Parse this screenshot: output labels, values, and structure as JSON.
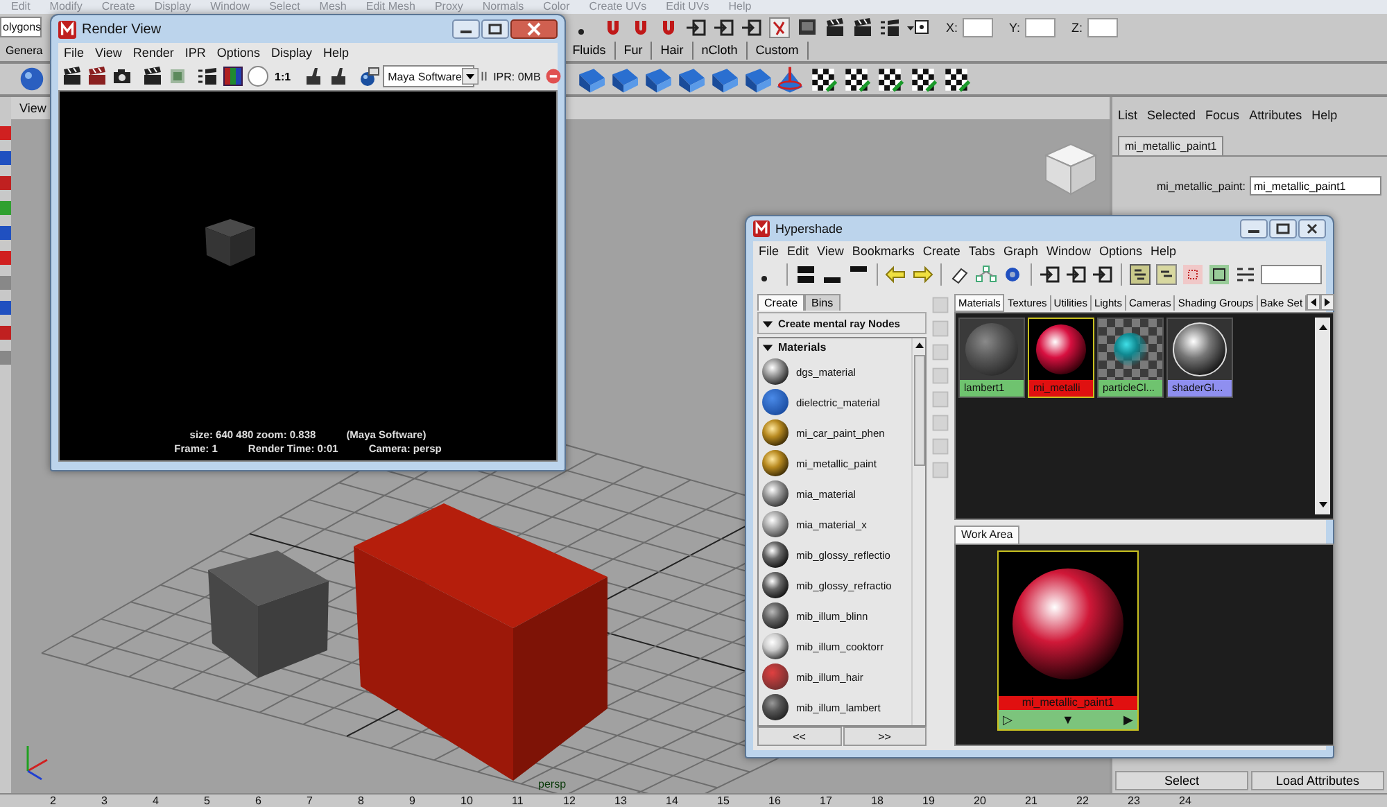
{
  "app": {
    "menu_bar": [
      "Edit",
      "Modify",
      "Create",
      "Display",
      "Window",
      "Select",
      "Mesh",
      "Edit Mesh",
      "Proxy",
      "Normals",
      "Color",
      "Create UVs",
      "Edit UVs",
      "Help"
    ],
    "menu_set": "olygons",
    "coordinate_fields": [
      {
        "label": "X:"
      },
      {
        "label": "Y:"
      },
      {
        "label": "Z:"
      }
    ],
    "shelf_tabs": [
      {
        "label": "Genera"
      },
      {
        "label": "Fluids"
      },
      {
        "label": "Fur"
      },
      {
        "label": "Hair"
      },
      {
        "label": "nCloth"
      },
      {
        "label": "Custom"
      }
    ]
  },
  "viewport": {
    "panel_menu": "View",
    "camera": "persp"
  },
  "attribute_editor": {
    "menu": [
      "List",
      "Selected",
      "Focus",
      "Attributes",
      "Help"
    ],
    "tabs": [
      {
        "label": "mi_metallic_paint1",
        "selected": true
      }
    ],
    "field": {
      "label": "mi_metallic_paint:",
      "value": "mi_metallic_paint1"
    },
    "buttons": [
      "Select",
      "Load Attributes"
    ]
  },
  "timeline": {
    "frames": [
      "2",
      "3",
      "4",
      "5",
      "6",
      "7",
      "8",
      "9",
      "10",
      "11",
      "12",
      "13",
      "14",
      "15",
      "16",
      "17",
      "18",
      "19",
      "20",
      "21",
      "22",
      "23",
      "24"
    ]
  },
  "render_view": {
    "title": "Render View",
    "menu": [
      "File",
      "View",
      "Render",
      "IPR",
      "Options",
      "Display",
      "Help"
    ],
    "zoom_button": "1:1",
    "renderer": "Maya Software",
    "ipr_memory": "IPR: 0MB",
    "info_lines": [
      [
        "size:  640  480 zoom: 0.838",
        "(Maya Software)"
      ],
      [
        "Frame: 1",
        "Render Time: 0:01",
        "Camera: persp"
      ]
    ]
  },
  "hypershade": {
    "title": "Hypershade",
    "menu": [
      "File",
      "Edit",
      "View",
      "Bookmarks",
      "Create",
      "Tabs",
      "Graph",
      "Window",
      "Options",
      "Help"
    ],
    "left_tabs": [
      {
        "label": "Create",
        "selected": true
      },
      {
        "label": "Bins",
        "selected": false
      }
    ],
    "create_header": {
      "label": "Create mental ray Nodes",
      "expanded": true
    },
    "section": {
      "label": "Materials",
      "expanded": true
    },
    "nodes": [
      "dgs_material",
      "dielectric_material",
      "mi_car_paint_phen",
      "mi_metallic_paint",
      "mia_material",
      "mia_material_x",
      "mib_glossy_reflectio",
      "mib_glossy_refractio",
      "mib_illum_blinn",
      "mib_illum_cooktorr",
      "mib_illum_hair",
      "mib_illum_lambert"
    ],
    "nav_buttons": [
      "<<",
      ">>"
    ],
    "tabs": [
      {
        "label": "Materials",
        "selected": true
      },
      {
        "label": "Textures",
        "selected": false
      },
      {
        "label": "Utilities",
        "selected": false
      },
      {
        "label": "Lights",
        "selected": false
      },
      {
        "label": "Cameras",
        "selected": false
      },
      {
        "label": "Shading Groups",
        "selected": false
      },
      {
        "label": "Bake Set",
        "selected": false
      }
    ],
    "swatches": [
      {
        "label": "lambert1",
        "kind": "matte",
        "color": "#6fc36f",
        "selected": false
      },
      {
        "label": "mi_metalli",
        "kind": "glow",
        "color": "#e01010",
        "selected": true
      },
      {
        "label": "particleCl...",
        "kind": "checker",
        "color": "#6fc36f",
        "selected": false
      },
      {
        "label": "shaderGl...",
        "kind": "chrome",
        "color": "#8f8ff0",
        "selected": false
      }
    ],
    "work_area": {
      "tab": "Work Area",
      "node": {
        "label": "mi_metallic_paint1",
        "controls": [
          "▷",
          "▼",
          "▶"
        ]
      }
    }
  }
}
